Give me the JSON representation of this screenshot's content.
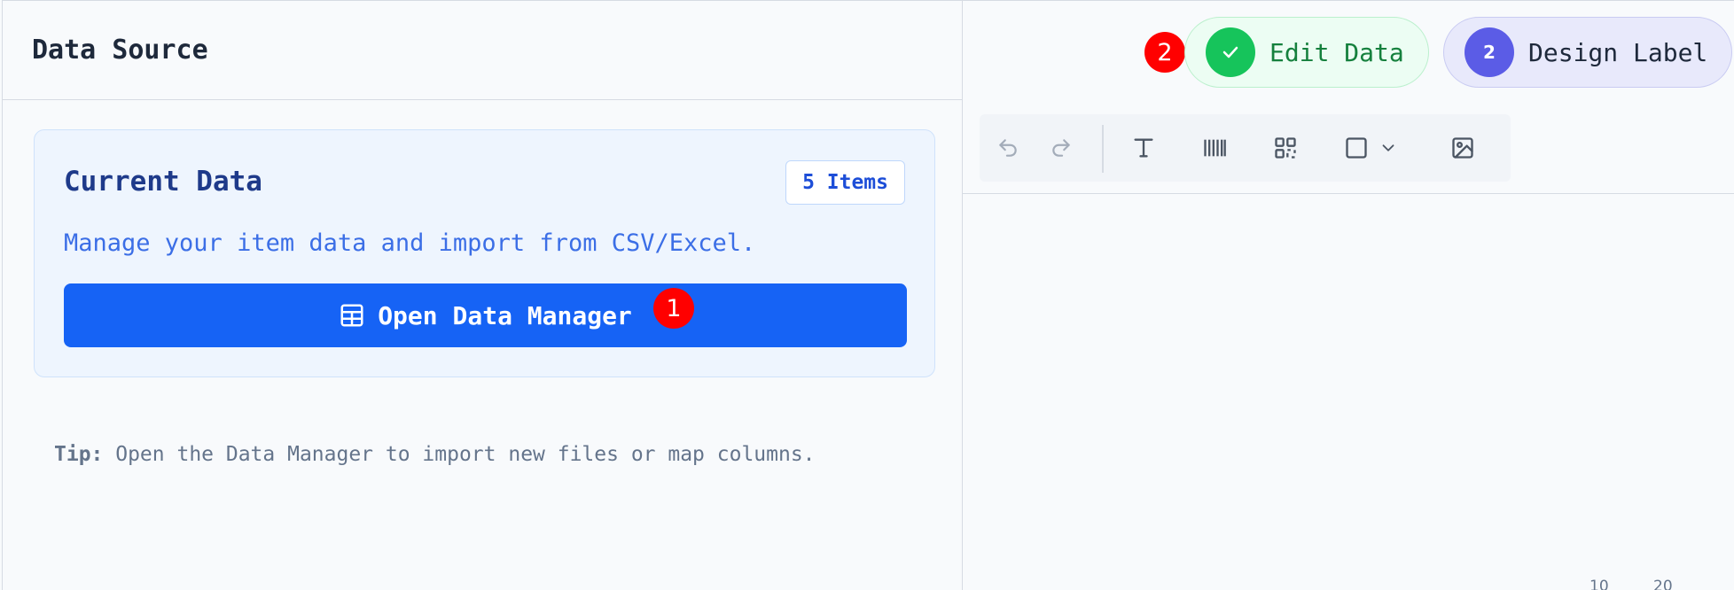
{
  "data_source": {
    "title": "Data Source",
    "card": {
      "title": "Current Data",
      "badge": "5 Items",
      "description": "Manage your item data and import from CSV/Excel.",
      "button_label": "Open Data Manager"
    },
    "tip_label": "Tip:",
    "tip_text": " Open the Data Manager to import new files or map columns."
  },
  "steps": [
    {
      "label": "Edit Data",
      "state": "complete",
      "icon": "check-icon"
    },
    {
      "label": "Design Label",
      "number": "2",
      "state": "active"
    }
  ],
  "markers": {
    "open_button": "1",
    "edit_data": "2"
  },
  "toolbar": {
    "tools": [
      "undo-icon",
      "redo-icon",
      "text-icon",
      "barcode-icon",
      "qr-code-icon",
      "shape-square-icon",
      "chevron-down-icon",
      "image-icon"
    ]
  },
  "ruler": {
    "ticks": [
      "10",
      "20"
    ]
  },
  "colors": {
    "primary": "#1663f5",
    "success": "#16c45b",
    "accent": "#5b5ce6",
    "marker": "#ff0000"
  }
}
